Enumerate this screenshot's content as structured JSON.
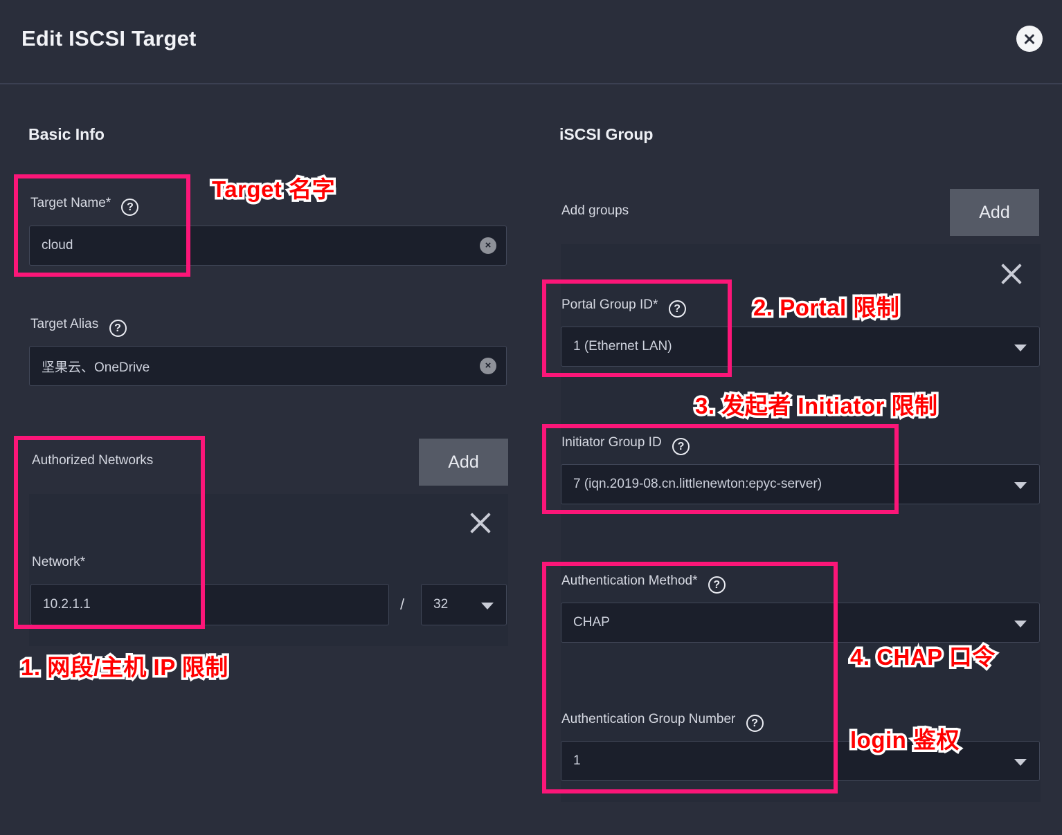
{
  "dialog": {
    "title": "Edit ISCSI Target",
    "close_label": "×"
  },
  "basic_info": {
    "heading": "Basic Info",
    "target_name": {
      "label": "Target Name",
      "required_mark": "*",
      "help": "?",
      "value": "cloud",
      "clear": "×"
    },
    "target_alias": {
      "label": "Target Alias",
      "help": "?",
      "value": "坚果云、OneDrive",
      "clear": "×"
    },
    "authorized_networks": {
      "label": "Authorized Networks",
      "add_label": "Add",
      "network": {
        "label": "Network",
        "required_mark": "*",
        "value": "10.2.1.1",
        "separator": "/",
        "prefix_value": "32"
      }
    }
  },
  "iscsi_group": {
    "heading": "iSCSI Group",
    "add_groups_label": "Add groups",
    "add_label": "Add",
    "portal_group": {
      "label": "Portal Group ID",
      "required_mark": "*",
      "help": "?",
      "value": "1 (Ethernet LAN)"
    },
    "initiator_group": {
      "label": "Initiator Group ID",
      "help": "?",
      "value": "7 (iqn.2019-08.cn.littlenewton:epyc-server)"
    },
    "auth_method": {
      "label": "Authentication Method",
      "required_mark": "*",
      "help": "?",
      "value": "CHAP"
    },
    "auth_group_number": {
      "label": "Authentication Group Number",
      "help": "?",
      "value": "1"
    }
  },
  "annotations": {
    "target_name": "Target 名字",
    "network": "1. 网段/主机 IP 限制",
    "portal": "2. Portal 限制",
    "initiator": "3. 发起者 Initiator 限制",
    "chap": "4. CHAP 口令",
    "login": "login 鉴权"
  },
  "colors": {
    "page_background": "#2a2e3b",
    "panel_background": "#262b38",
    "input_background": "#1b1f2b",
    "highlight_pink": "#fb1678",
    "annotation_red": "#ff0000",
    "button_gray": "#555a66"
  }
}
